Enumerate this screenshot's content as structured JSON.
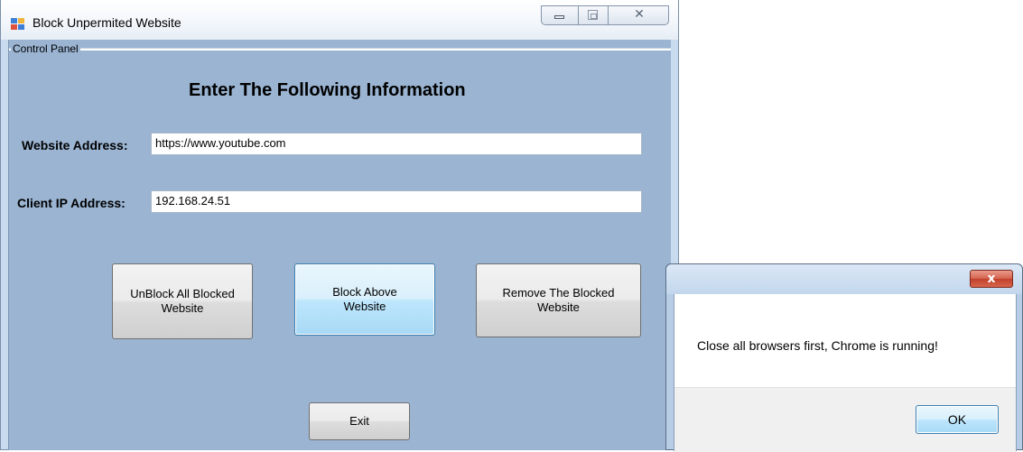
{
  "main_window": {
    "title": "Block Unpermited Website",
    "groupbox_label": "Control Panel",
    "heading": "Enter The Following Information",
    "website_label": "Website Address:",
    "website_value": "https://www.youtube.com",
    "client_ip_label": "Client IP Address:",
    "client_ip_value": "192.168.24.51",
    "buttons": {
      "unblock_all": "UnBlock All Blocked Website",
      "block_above": "Block Above Website",
      "remove_blocked": "Remove The Blocked Website",
      "exit": "Exit"
    }
  },
  "message_box": {
    "close_glyph": "x",
    "message": "Close all browsers first, Chrome is running!",
    "ok_label": "OK"
  },
  "colors": {
    "form_background": "#9ab4d2",
    "button_hover_accent": "#3c7fb1",
    "close_button": "#c2402c"
  },
  "icons": {
    "app": "app-window-icon",
    "minimize": "minimize-icon",
    "maximize": "maximize-icon",
    "close": "close-icon"
  }
}
